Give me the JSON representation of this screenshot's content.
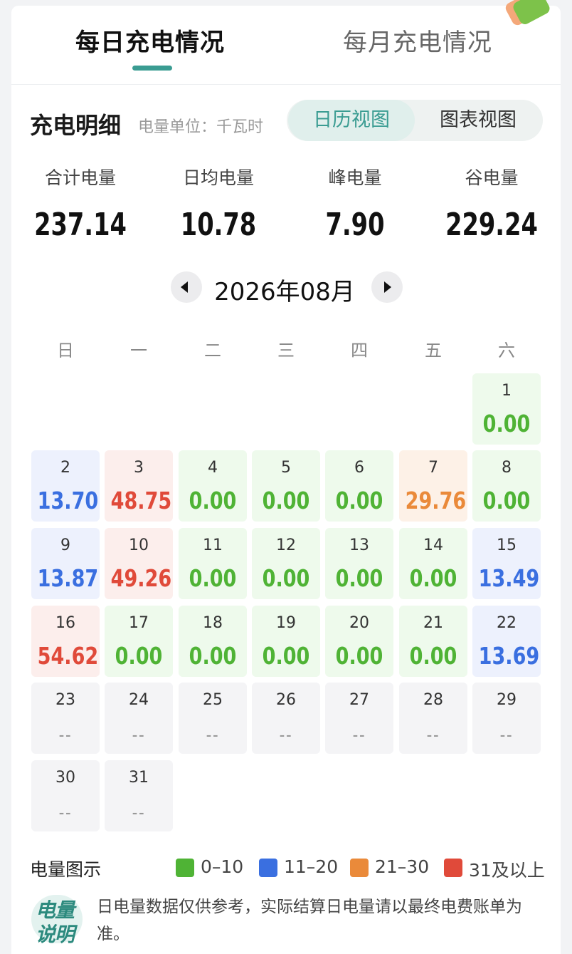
{
  "tabs": {
    "daily": "每日充电情况",
    "monthly": "每月充电情况"
  },
  "header": {
    "title": "充电明细",
    "unit": "电量单位：千瓦时",
    "calendar_view": "日历视图",
    "chart_view": "图表视图"
  },
  "stats": [
    {
      "label": "合计电量",
      "value": "237.14"
    },
    {
      "label": "日均电量",
      "value": "10.78"
    },
    {
      "label": "峰电量",
      "value": "7.90"
    },
    {
      "label": "谷电量",
      "value": "229.24"
    }
  ],
  "month": "2026年08月",
  "weekdays": [
    "日",
    "一",
    "二",
    "三",
    "四",
    "五",
    "六"
  ],
  "days": [
    {
      "day": "1",
      "value": "0.00",
      "level": "green"
    },
    {
      "day": "2",
      "value": "13.70",
      "level": "blue"
    },
    {
      "day": "3",
      "value": "48.75",
      "level": "red"
    },
    {
      "day": "4",
      "value": "0.00",
      "level": "green"
    },
    {
      "day": "5",
      "value": "0.00",
      "level": "green"
    },
    {
      "day": "6",
      "value": "0.00",
      "level": "green"
    },
    {
      "day": "7",
      "value": "29.76",
      "level": "orange"
    },
    {
      "day": "8",
      "value": "0.00",
      "level": "green"
    },
    {
      "day": "9",
      "value": "13.87",
      "level": "blue"
    },
    {
      "day": "10",
      "value": "49.26",
      "level": "red"
    },
    {
      "day": "11",
      "value": "0.00",
      "level": "green"
    },
    {
      "day": "12",
      "value": "0.00",
      "level": "green"
    },
    {
      "day": "13",
      "value": "0.00",
      "level": "green"
    },
    {
      "day": "14",
      "value": "0.00",
      "level": "green"
    },
    {
      "day": "15",
      "value": "13.49",
      "level": "blue"
    },
    {
      "day": "16",
      "value": "54.62",
      "level": "red"
    },
    {
      "day": "17",
      "value": "0.00",
      "level": "green"
    },
    {
      "day": "18",
      "value": "0.00",
      "level": "green"
    },
    {
      "day": "19",
      "value": "0.00",
      "level": "green"
    },
    {
      "day": "20",
      "value": "0.00",
      "level": "green"
    },
    {
      "day": "21",
      "value": "0.00",
      "level": "green"
    },
    {
      "day": "22",
      "value": "13.69",
      "level": "blue"
    },
    {
      "day": "23",
      "value": "--",
      "level": "none"
    },
    {
      "day": "24",
      "value": "--",
      "level": "none"
    },
    {
      "day": "25",
      "value": "--",
      "level": "none"
    },
    {
      "day": "26",
      "value": "--",
      "level": "none"
    },
    {
      "day": "27",
      "value": "--",
      "level": "none"
    },
    {
      "day": "28",
      "value": "--",
      "level": "none"
    },
    {
      "day": "29",
      "value": "--",
      "level": "none"
    },
    {
      "day": "30",
      "value": "--",
      "level": "none"
    },
    {
      "day": "31",
      "value": "--",
      "level": "none"
    }
  ],
  "legend": {
    "title": "电量图示",
    "items": [
      {
        "label": "0–10",
        "color": "#4fb335"
      },
      {
        "label": "11–20",
        "color": "#3a6fe0"
      },
      {
        "label": "21–30",
        "color": "#ea8a3a"
      },
      {
        "label": "31及以上",
        "color": "#e04a3a"
      }
    ]
  },
  "note": {
    "icon_line1": "电量",
    "icon_line2": "说明",
    "text": "日电量数据仅供参考，实际结算日电量请以最终电费账单为准。"
  }
}
